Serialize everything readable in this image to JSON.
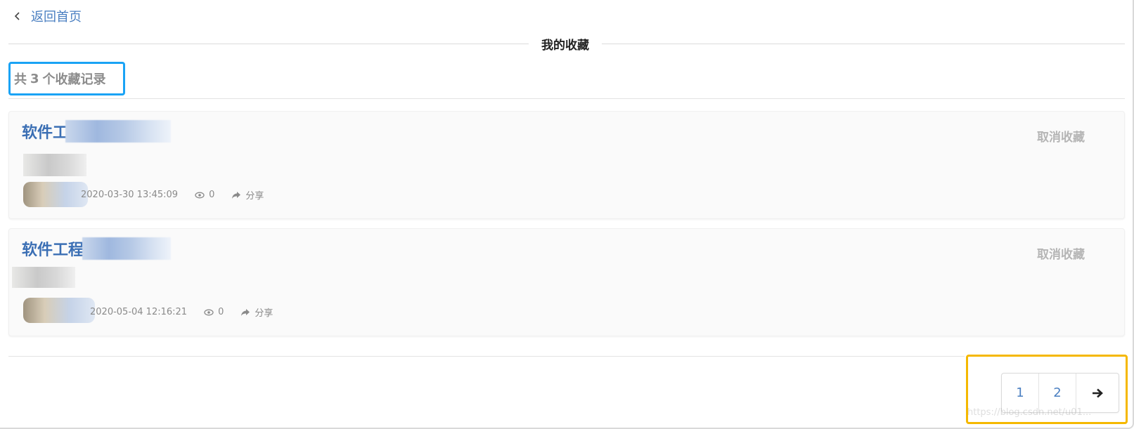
{
  "nav": {
    "back_label": "返回首页"
  },
  "header": {
    "title": "我的收藏"
  },
  "summary": {
    "prefix": "共",
    "count": "3",
    "suffix": "个收藏记录"
  },
  "favorites": [
    {
      "title": "软件工程",
      "date": "2020-03-30 13:45:09",
      "views": "0",
      "share_label": "分享",
      "cancel_label": "取消收藏"
    },
    {
      "title": "软件工程讠",
      "date": "2020-05-04 12:16:21",
      "views": "0",
      "share_label": "分享",
      "cancel_label": "取消收藏"
    }
  ],
  "pagination": {
    "pages": [
      "1",
      "2"
    ],
    "next_icon": "arrow-right-icon"
  },
  "watermark": "https://blog.csdn.net/u01...",
  "colors": {
    "link": "#4a7fc1",
    "highlight_blue": "#1aa3f5",
    "highlight_yellow": "#f5b800"
  }
}
